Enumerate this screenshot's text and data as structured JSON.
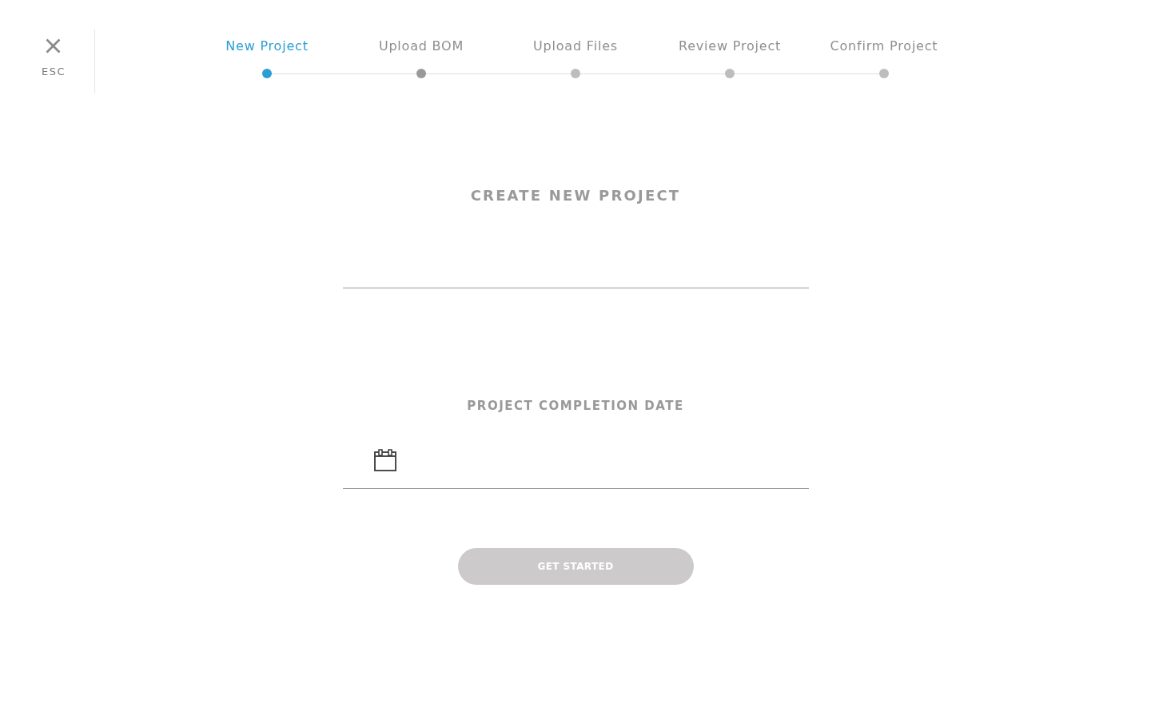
{
  "close": {
    "label": "ESC"
  },
  "steps": [
    {
      "label": "New Project",
      "selected": true,
      "available": true
    },
    {
      "label": "Upload BOM",
      "selected": false,
      "available": true
    },
    {
      "label": "Upload Files",
      "selected": false,
      "available": false
    },
    {
      "label": "Review Project",
      "selected": false,
      "available": false
    },
    {
      "label": "Confirm Project",
      "selected": false,
      "available": false
    }
  ],
  "form": {
    "title": "CREATE NEW PROJECT",
    "fields": [
      {
        "kind": "text"
      },
      {
        "kind": "date",
        "label": "PROJECT COMPLETION DATE"
      }
    ],
    "button": {
      "label": "GET STARTED",
      "disabled": true
    }
  }
}
